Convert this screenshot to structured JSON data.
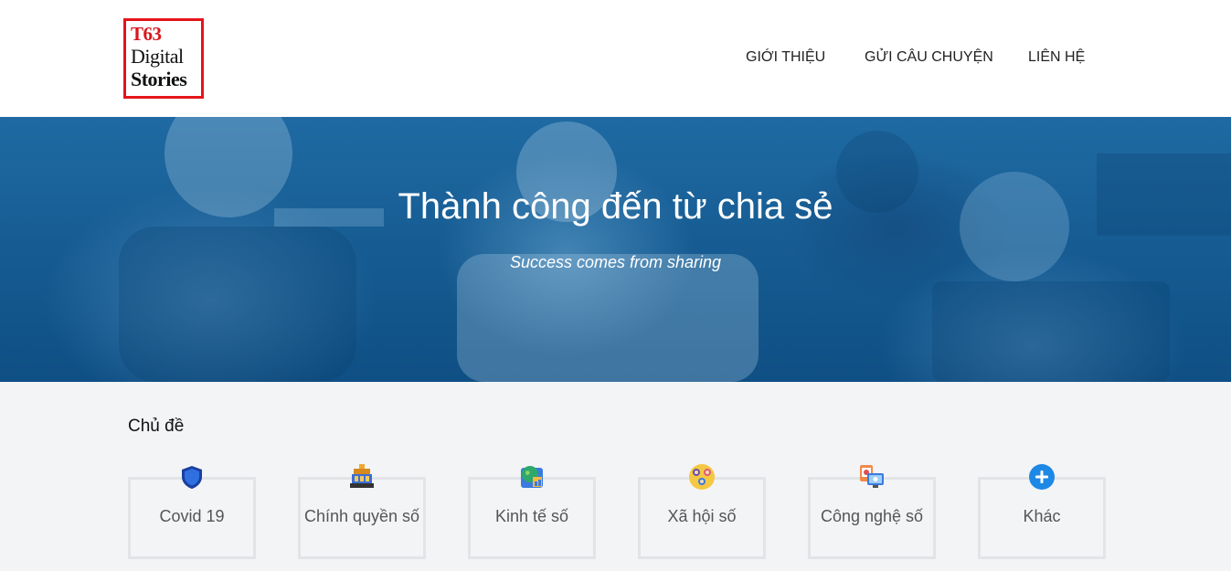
{
  "logo": {
    "line1": "T63",
    "line2": "Digital",
    "line3": "Stories"
  },
  "nav": {
    "about": "GIỚI THIỆU",
    "submit": "GỬI CÂU CHUYỆN",
    "contact": "LIÊN HỆ"
  },
  "hero": {
    "title": "Thành công đến từ chia sẻ",
    "subtitle": "Success comes from sharing"
  },
  "topics": {
    "title": "Chủ đề",
    "items": [
      {
        "label": "Covid 19",
        "icon": "shield-icon"
      },
      {
        "label": "Chính quyền số",
        "icon": "government-icon"
      },
      {
        "label": "Kinh tế số",
        "icon": "globe-icon"
      },
      {
        "label": "Xã hội số",
        "icon": "people-icon"
      },
      {
        "label": "Công nghệ số",
        "icon": "computer-icon"
      },
      {
        "label": "Khác",
        "icon": "plus-circle-icon"
      }
    ]
  },
  "colors": {
    "logo_red": "#e3151a",
    "hero_blue": "#14598f",
    "accent_blue": "#1e88e5"
  }
}
